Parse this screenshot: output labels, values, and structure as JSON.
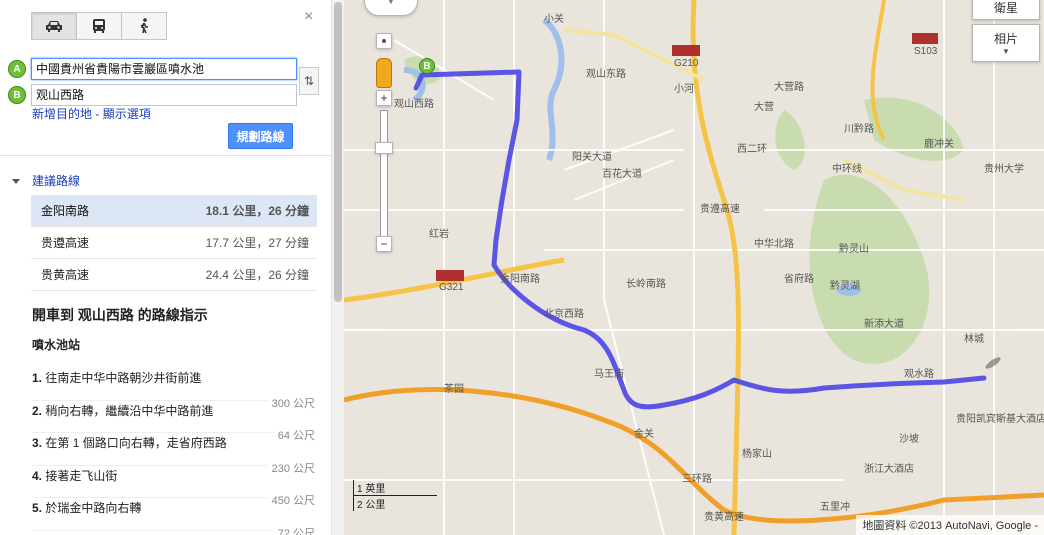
{
  "travel_modes": [
    {
      "name": "car-icon",
      "label": "🚗"
    },
    {
      "name": "bus-icon",
      "label": "🚌"
    },
    {
      "name": "walk-icon",
      "label": "🚶"
    }
  ],
  "close_label": "×",
  "waypoints": {
    "a_marker": "A",
    "b_marker": "B",
    "start_value": "中國貴州省貴陽市雲巖區噴水池",
    "end_value": "观山西路"
  },
  "swap_label": "⇅",
  "links": {
    "add_destination": "新增目的地",
    "separator": " - ",
    "show_options": "顯示選項"
  },
  "plan_button": "規劃路線",
  "suggested_routes_label": "建議路線",
  "routes": [
    {
      "name": "金阳南路",
      "meta": "18.1 公里，26 分鐘"
    },
    {
      "name": "贵遵高速",
      "meta": "17.7 公里，27 分鐘"
    },
    {
      "name": "贵黄高速",
      "meta": "24.4 公里，26 分鐘"
    }
  ],
  "directions_title": "開車到 观山西路 的路線指示",
  "start_name": "噴水池站",
  "steps": [
    {
      "num": "1.",
      "text": "往南走中华中路朝沙井街前進",
      "dist": "300 公尺"
    },
    {
      "num": "2.",
      "text": "稍向右轉，繼續沿中华中路前進",
      "dist": "64 公尺"
    },
    {
      "num": "3.",
      "text": "在第 1 個路口向右轉，走省府西路",
      "dist": "230 公尺"
    },
    {
      "num": "4.",
      "text": "接著走飞山街",
      "dist": "450 公尺"
    },
    {
      "num": "5.",
      "text": "於瑞金中路向右轉",
      "dist": "72 公尺"
    }
  ],
  "map": {
    "satellite_button": "衛星",
    "photos_button": "相片",
    "scale_imperial": "1 英里",
    "scale_metric": "2 公里",
    "copyright": "地圖資料 ©2013 AutoNavi, Google -",
    "labels": [
      "小关",
      "小河",
      "金阳南路",
      "观山东路",
      "观山西路",
      "阳关大道",
      "百花大道",
      "贵遵高速",
      "中环线",
      "黔灵湖",
      "贵阳凯宾斯基大酒店",
      "五里冲",
      "西二环",
      "三环路",
      "贵黄高速",
      "G321",
      "G210",
      "S103",
      "北京西路",
      "川黔路",
      "新添大道",
      "林城",
      "黔灵山",
      "马王庙",
      "杨家山",
      "浙江大酒店",
      "观水路",
      "中华北路",
      "沙坡",
      "金关",
      "省府路",
      "长岭南路",
      "贵州大学",
      "大营",
      "大营路",
      "茶园",
      "红岩",
      "鹿冲关"
    ],
    "route_color": "#4a45e4"
  }
}
